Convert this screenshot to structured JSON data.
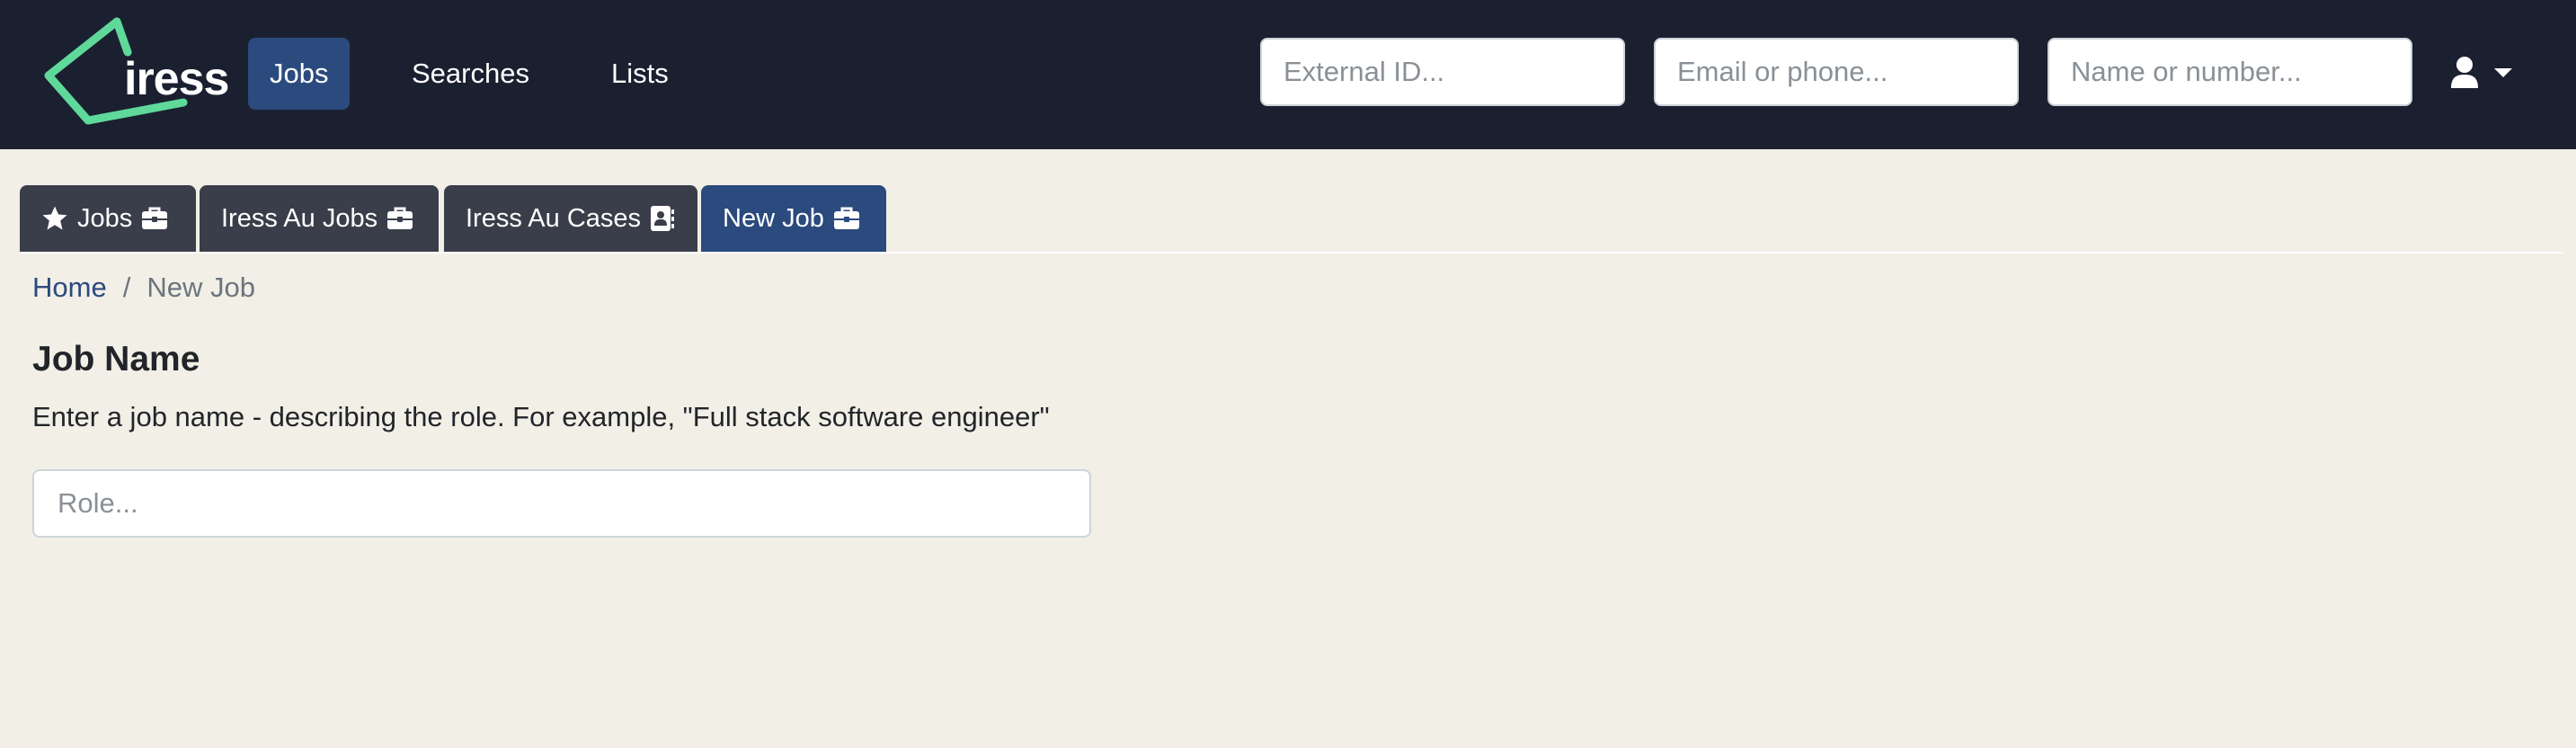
{
  "navbar": {
    "logo_text": "iress",
    "links": [
      {
        "label": "Jobs",
        "active": true
      },
      {
        "label": "Searches",
        "active": false
      },
      {
        "label": "Lists",
        "active": false
      }
    ],
    "search_inputs": {
      "external_id_placeholder": "External ID...",
      "email_phone_placeholder": "Email or phone...",
      "name_number_placeholder": "Name or number..."
    },
    "user_menu_icon": "user-icon"
  },
  "tabs": [
    {
      "label": "Jobs",
      "icon_before": "star-icon",
      "icon_after": "briefcase-icon",
      "active": false
    },
    {
      "label": "Iress Au Jobs",
      "icon_after": "briefcase-icon",
      "active": false
    },
    {
      "label": "Iress Au Cases",
      "icon_after": "address-book-icon",
      "active": false
    },
    {
      "label": "New Job",
      "icon_after": "briefcase-icon",
      "active": true
    }
  ],
  "breadcrumb": {
    "home": "Home",
    "separator": "/",
    "current": "New Job"
  },
  "main": {
    "title": "Job Name",
    "description": "Enter a job name - describing the role. For example, \"Full stack software engineer\"",
    "role_placeholder": "Role..."
  },
  "colors": {
    "navbar_bg": "#1b2030",
    "accent": "#2b4a7d",
    "tab_bg": "#3a3e4a",
    "page_bg": "#f2efe7",
    "logo_green": "#5fd99a"
  }
}
